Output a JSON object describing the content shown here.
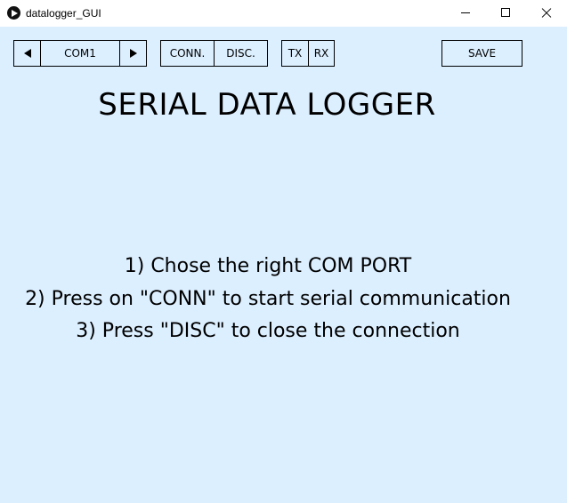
{
  "window": {
    "title": "datalogger_GUI"
  },
  "toolbar": {
    "prev_port_icon": "left-triangle",
    "port_value": "COM1",
    "next_port_icon": "right-triangle",
    "conn_label": "CONN.",
    "disc_label": "DISC.",
    "tx_label": "TX",
    "rx_label": "RX",
    "save_label": "SAVE"
  },
  "main": {
    "title": "SERIAL DATA LOGGER",
    "instructions": [
      "1) Chose the right COM PORT",
      "2) Press on \"CONN\" to start serial communication",
      "3) Press \"DISC\" to close the connection"
    ]
  },
  "colors": {
    "canvas_background": "#dcefff",
    "titlebar_background": "#ffffff",
    "text": "#000000"
  }
}
